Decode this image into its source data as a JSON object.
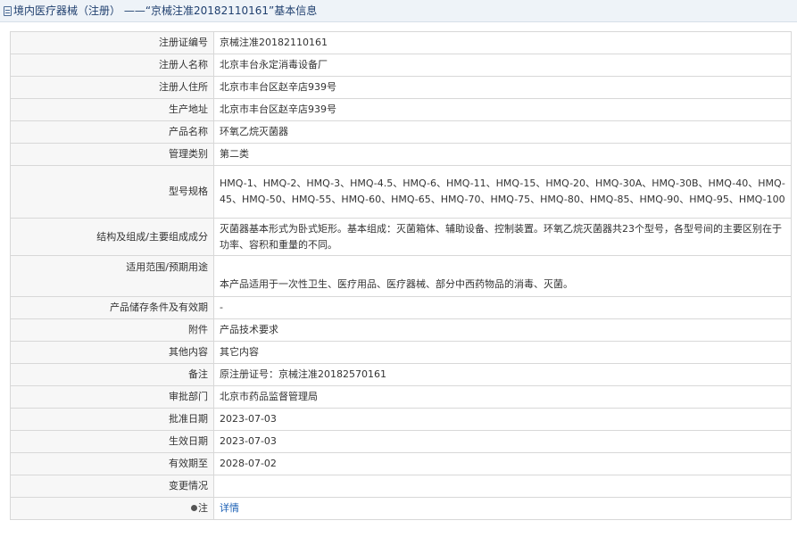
{
  "header": {
    "title": "境内医疗器械（注册） ——“京械注准20182110161”基本信息"
  },
  "rows": [
    {
      "label": "注册证编号",
      "value": "京械注准20182110161"
    },
    {
      "label": "注册人名称",
      "value": "北京丰台永定消毒设备厂"
    },
    {
      "label": "注册人住所",
      "value": "北京市丰台区赵辛店939号"
    },
    {
      "label": "生产地址",
      "value": "北京市丰台区赵辛店939号"
    },
    {
      "label": "产品名称",
      "value": "环氧乙烷灭菌器"
    },
    {
      "label": "管理类别",
      "value": "第二类"
    },
    {
      "label": "型号规格",
      "value": "HMQ-1、HMQ-2、HMQ-3、HMQ-4.5、HMQ-6、HMQ-11、HMQ-15、HMQ-20、HMQ-30A、HMQ-30B、HMQ-40、HMQ-45、HMQ-50、HMQ-55、HMQ-60、HMQ-65、HMQ-70、HMQ-75、HMQ-80、HMQ-85、HMQ-90、HMQ-95、HMQ-100"
    },
    {
      "label": "结构及组成/主要组成成分",
      "value": "灭菌器基本形式为卧式矩形。基本组成：灭菌箱体、辅助设备、控制装置。环氧乙烷灭菌器共23个型号，各型号间的主要区别在于功率、容积和重量的不同。"
    },
    {
      "label": "适用范围/预期用途",
      "value": "本产品适用于一次性卫生、医疗用品、医疗器械、部分中西药物品的消毒、灭菌。"
    },
    {
      "label": "产品储存条件及有效期",
      "value": "-"
    },
    {
      "label": "附件",
      "value": "产品技术要求"
    },
    {
      "label": "其他内容",
      "value": "其它内容"
    },
    {
      "label": "备注",
      "value": "原注册证号：京械注准20182570161"
    },
    {
      "label": "审批部门",
      "value": "北京市药品监督管理局"
    },
    {
      "label": "批准日期",
      "value": "2023-07-03"
    },
    {
      "label": "生效日期",
      "value": "2023-07-03"
    },
    {
      "label": "有效期至",
      "value": "2028-07-02"
    },
    {
      "label": "变更情况",
      "value": ""
    },
    {
      "label": "注",
      "value": "详情"
    }
  ]
}
